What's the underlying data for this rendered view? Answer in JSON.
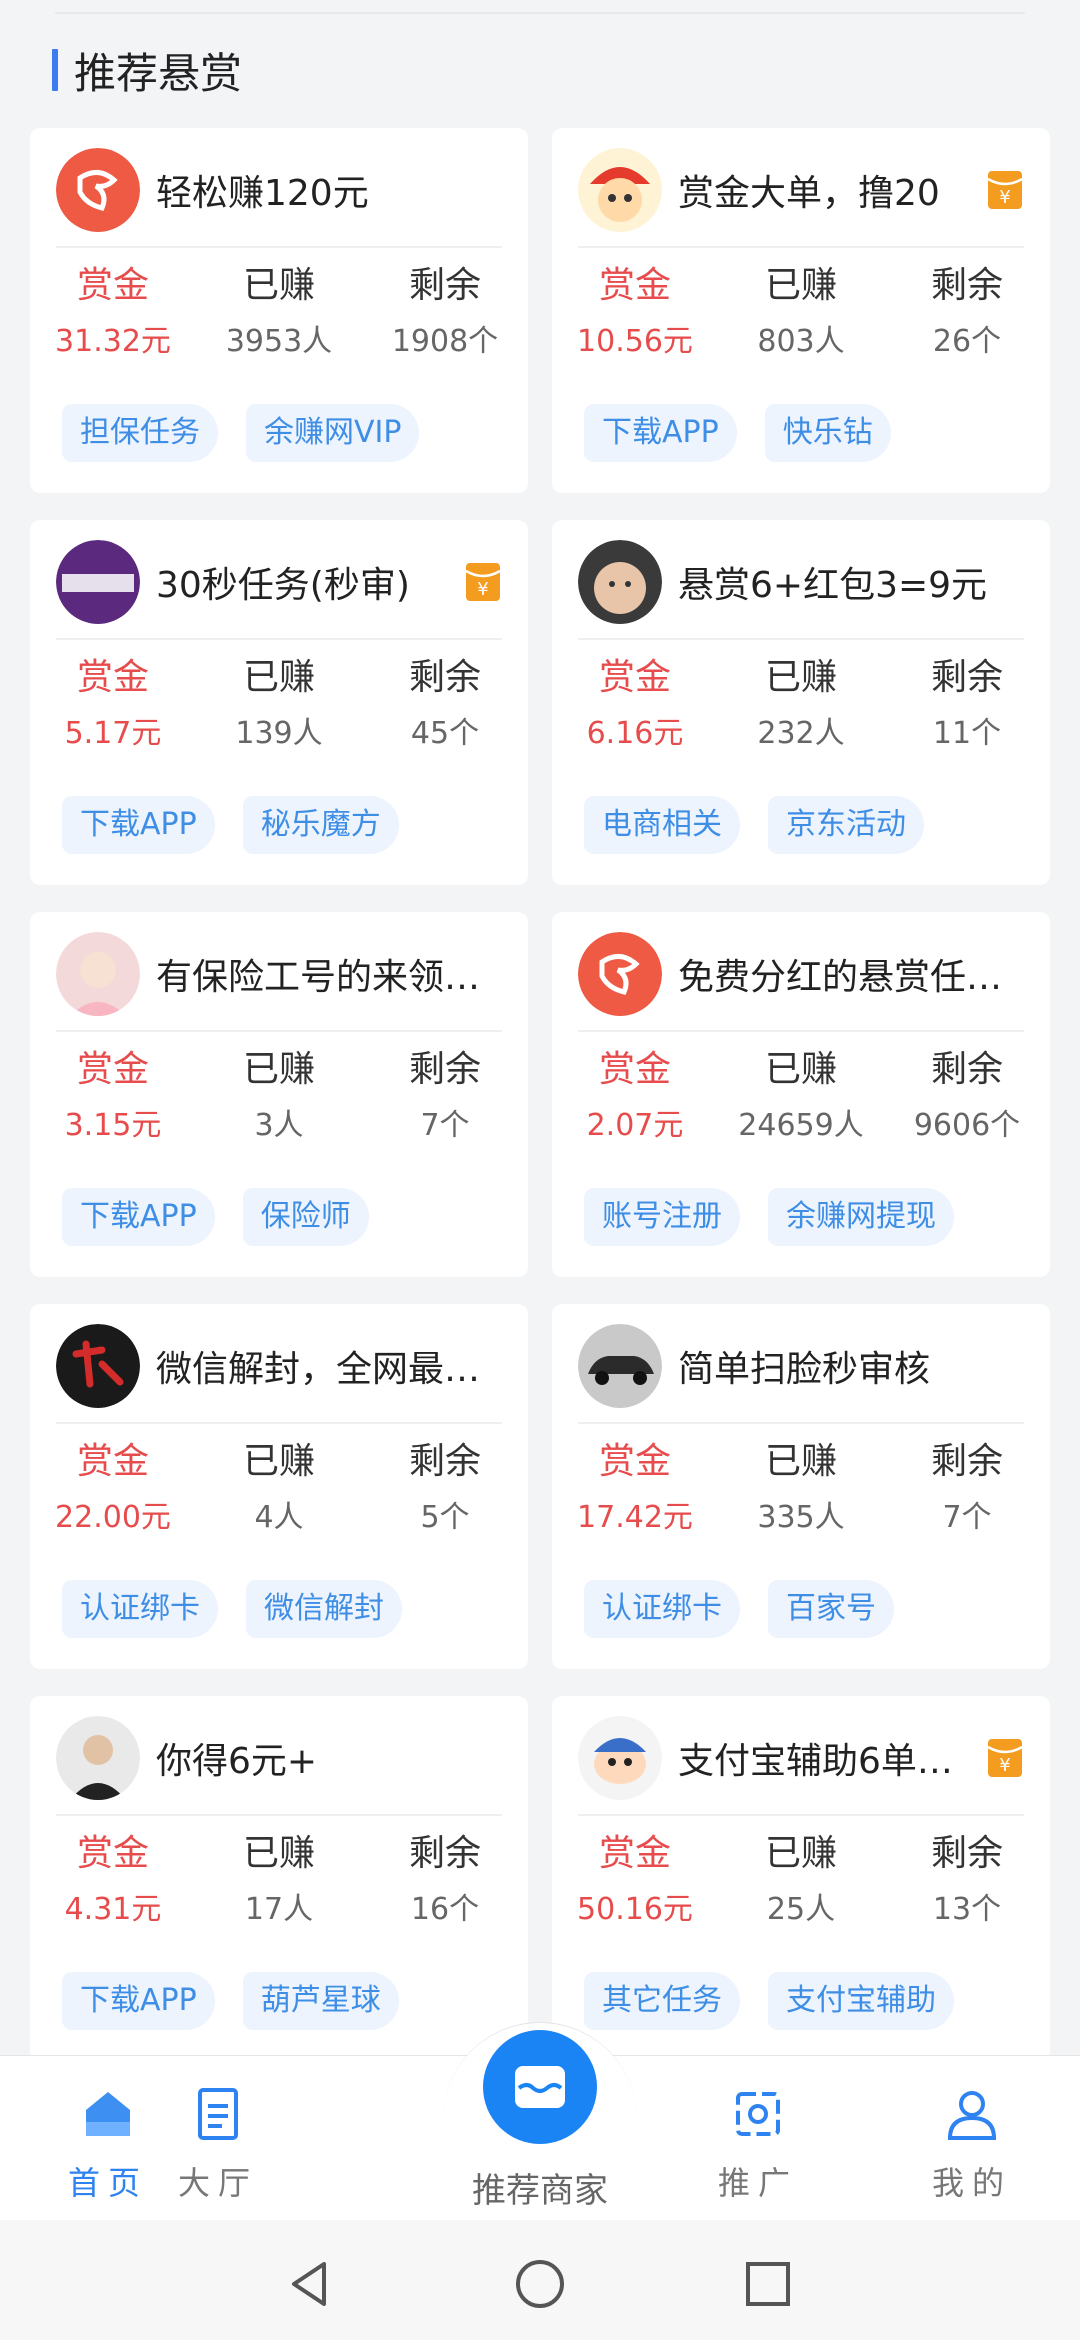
{
  "section": {
    "title": "推荐悬赏"
  },
  "cards": [
    {
      "title": "轻松赚120元",
      "avatar": "brand-logo-red",
      "badge": false,
      "reward_label": "赏金",
      "earned_label": "已赚",
      "remain_label": "剩余",
      "reward": "31.32元",
      "earned": "3953人",
      "remain": "1908个",
      "tags": [
        "担保任务",
        "余赚网VIP"
      ]
    },
    {
      "title": "赏金大单，撸20",
      "avatar": "cartoon-boy",
      "badge": true,
      "reward_label": "赏金",
      "earned_label": "已赚",
      "remain_label": "剩余",
      "reward": "10.56元",
      "earned": "803人",
      "remain": "26个",
      "tags": [
        "下载APP",
        "快乐钻"
      ]
    },
    {
      "title": "30秒任务(秒审)",
      "avatar": "invest-logo",
      "badge": true,
      "reward_label": "赏金",
      "earned_label": "已赚",
      "remain_label": "剩余",
      "reward": "5.17元",
      "earned": "139人",
      "remain": "45个",
      "tags": [
        "下载APP",
        "秘乐魔方"
      ]
    },
    {
      "title": "悬赏6+红包3=9元",
      "avatar": "child-face",
      "badge": false,
      "reward_label": "赏金",
      "earned_label": "已赚",
      "remain_label": "剩余",
      "reward": "6.16元",
      "earned": "232人",
      "remain": "11个",
      "tags": [
        "电商相关",
        "京东活动"
      ]
    },
    {
      "title": "有保险工号的来领…",
      "avatar": "woman-photo",
      "badge": false,
      "reward_label": "赏金",
      "earned_label": "已赚",
      "remain_label": "剩余",
      "reward": "3.15元",
      "earned": "3人",
      "remain": "7个",
      "tags": [
        "下载APP",
        "保险师"
      ]
    },
    {
      "title": "免费分红的悬赏任…",
      "avatar": "brand-logo-red",
      "badge": false,
      "reward_label": "赏金",
      "earned_label": "已赚",
      "remain_label": "剩余",
      "reward": "2.07元",
      "earned": "24659人",
      "remain": "9606个",
      "tags": [
        "账号注册",
        "余赚网提现"
      ]
    },
    {
      "title": "微信解封，全网最…",
      "avatar": "calligraphy-logo",
      "badge": false,
      "reward_label": "赏金",
      "earned_label": "已赚",
      "remain_label": "剩余",
      "reward": "22.00元",
      "earned": "4人",
      "remain": "5个",
      "tags": [
        "认证绑卡",
        "微信解封"
      ]
    },
    {
      "title": "简单扫脸秒审核",
      "avatar": "car-photo",
      "badge": false,
      "reward_label": "赏金",
      "earned_label": "已赚",
      "remain_label": "剩余",
      "reward": "17.42元",
      "earned": "335人",
      "remain": "7个",
      "tags": [
        "认证绑卡",
        "百家号"
      ]
    },
    {
      "title": "你得6元+",
      "avatar": "man-photo",
      "badge": false,
      "reward_label": "赏金",
      "earned_label": "已赚",
      "remain_label": "剩余",
      "reward": "4.31元",
      "earned": "17人",
      "remain": "16个",
      "tags": [
        "下载APP",
        "葫芦星球"
      ]
    },
    {
      "title": "支付宝辅助6单…",
      "avatar": "cartoon-shinchan",
      "badge": true,
      "reward_label": "赏金",
      "earned_label": "已赚",
      "remain_label": "剩余",
      "reward": "50.16元",
      "earned": "25人",
      "remain": "13个",
      "tags": [
        "其它任务",
        "支付宝辅助"
      ]
    }
  ],
  "nav": {
    "home": "首页",
    "hall": "大厅",
    "center": "推荐商家",
    "promote": "推广",
    "mine": "我的"
  },
  "colors": {
    "accent": "#2f83f0",
    "reward": "#e74c4c",
    "tag_bg": "#edf4fd",
    "tag_text": "#3e8ee6"
  }
}
